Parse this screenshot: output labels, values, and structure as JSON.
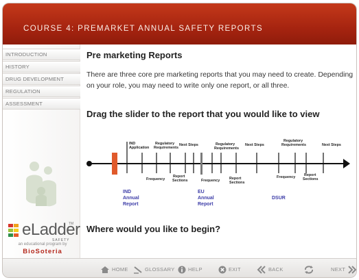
{
  "header": {
    "course_title": "Course 4: Premarket Annual Safety Reports"
  },
  "sidebar": {
    "items": [
      {
        "label": "INTRODUCTION"
      },
      {
        "label": "HISTORY"
      },
      {
        "label": "DRUG DEVELOPMENT"
      },
      {
        "label": "REGULATION"
      },
      {
        "label": "ASSESSMENT"
      }
    ]
  },
  "logo": {
    "word": "eLadder",
    "trademark": "TM",
    "sub": "SAFETY",
    "tagline": "an educational program by",
    "brand": "BioSoteria"
  },
  "main": {
    "title": "Pre marketing Reports",
    "intro": "There are three core pre marketing reports that you may need to create. Depending on your role, you may need to write only one report, or all three.",
    "slider_heading": "Drag the slider to the report that you would like to view",
    "begin_heading": "Where would you like to begin?"
  },
  "timeline": {
    "labels": {
      "ind_application": [
        "IND",
        "Application"
      ],
      "reg_req_1": [
        "Regulatory",
        "Requirements"
      ],
      "next_steps_1": "Next Steps",
      "reg_req_2": [
        "Regulatory",
        "Requirements"
      ],
      "next_steps_2": "Next Steps",
      "reg_req_3": [
        "Regulatory",
        "Requirements"
      ],
      "next_steps_3": "Next Steps",
      "frequency_1": "Frequency",
      "report_sections_1": [
        "Report",
        "Sections"
      ],
      "frequency_2": "Frequency",
      "report_sections_2": [
        "Report",
        "Sections"
      ],
      "frequency_3": "Frequency",
      "report_sections_3": [
        "Report",
        "Sections"
      ]
    },
    "reports": {
      "ind": [
        "IND",
        "Annual",
        "Report"
      ],
      "eu": [
        "EU",
        "Annual",
        "Report"
      ],
      "dsur": "DSUR"
    },
    "slider_color": "#e05a2b"
  },
  "footer": {
    "home": "HOME",
    "glossary": "GLOSSARY",
    "help": "HELP",
    "exit": "EXIT",
    "back": "BACK",
    "next": "NEXT"
  },
  "colors": {
    "header": "#a62410",
    "accent_blue": "#3d3da8",
    "brand_red": "#b3261a"
  }
}
